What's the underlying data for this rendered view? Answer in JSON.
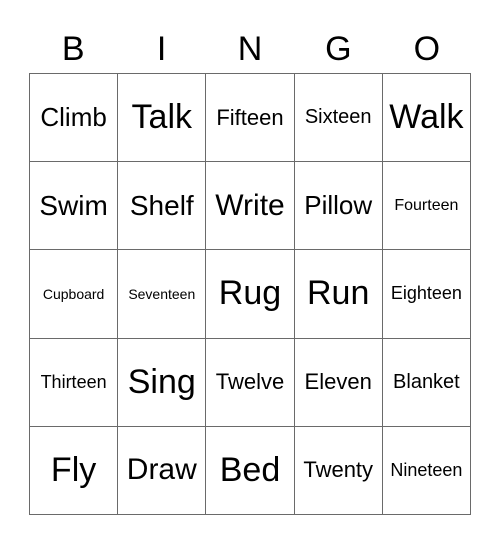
{
  "header": {
    "letters": [
      "B",
      "I",
      "N",
      "G",
      "O"
    ]
  },
  "board": {
    "rows": [
      [
        "Climb",
        "Talk",
        "Fifteen",
        "Sixteen",
        "Walk"
      ],
      [
        "Swim",
        "Shelf",
        "Write",
        "Pillow",
        "Fourteen"
      ],
      [
        "Cupboard",
        "Seventeen",
        "Rug",
        "Run",
        "Eighteen"
      ],
      [
        "Thirteen",
        "Sing",
        "Twelve",
        "Eleven",
        "Blanket"
      ],
      [
        "Fly",
        "Draw",
        "Bed",
        "Twenty",
        "Nineteen"
      ]
    ]
  }
}
